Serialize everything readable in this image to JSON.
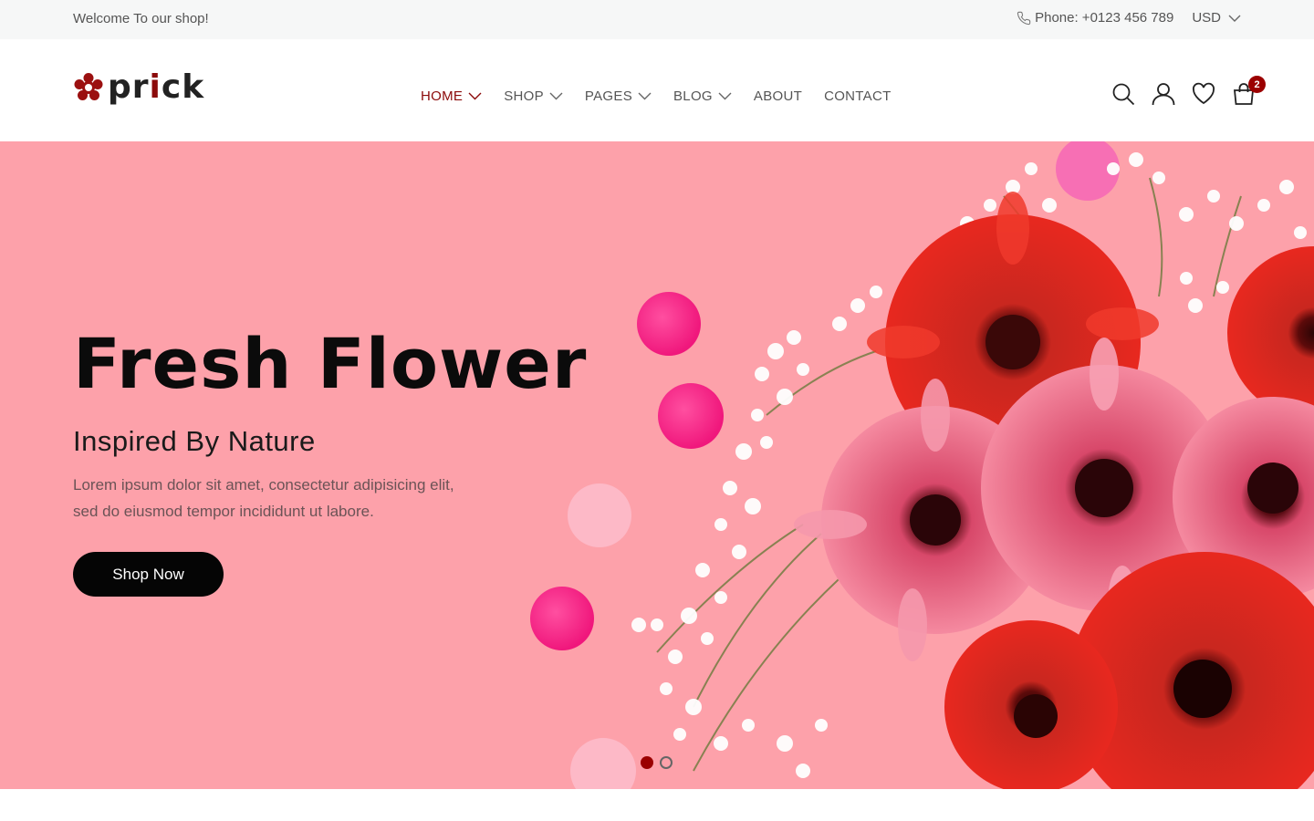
{
  "topbar": {
    "welcome": "Welcome To our shop!",
    "phone": "Phone: +0123 456 789",
    "currency": "USD"
  },
  "header": {
    "logo_pre": "pr",
    "logo_accent": "i",
    "logo_post": "ck",
    "nav": [
      {
        "label": "HOME",
        "has_dropdown": true,
        "active": true
      },
      {
        "label": "SHOP",
        "has_dropdown": true
      },
      {
        "label": "PAGES",
        "has_dropdown": true
      },
      {
        "label": "BLOG",
        "has_dropdown": true
      },
      {
        "label": "ABOUT",
        "has_dropdown": false
      },
      {
        "label": "CONTACT",
        "has_dropdown": false
      }
    ],
    "icons": [
      "search-icon",
      "user-icon",
      "heart-icon",
      "cart-icon"
    ],
    "cart_count": "2"
  },
  "hero": {
    "title": "Fresh Flower",
    "subtitle": "Inspired By Nature",
    "text_line1": "Lorem ipsum dolor sit amet, consectetur adipisicing elit,",
    "text_line2": "sed do eiusmod tempor incididunt ut labore.",
    "button": "Shop Now",
    "slides": 2,
    "active_slide": 1
  },
  "colors": {
    "accent": "#8b0a0a",
    "hero_bg": "#fda1aa",
    "button_bg": "#050505",
    "topbar_bg": "#f6f7f7"
  }
}
